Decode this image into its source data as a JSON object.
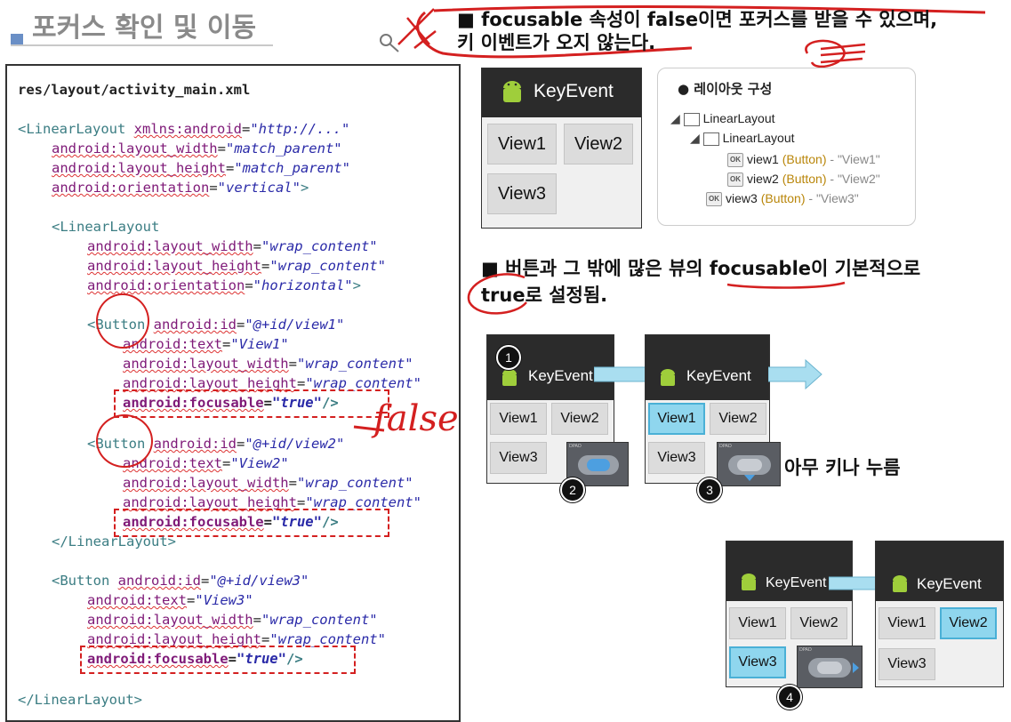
{
  "header": {
    "title": "포커스 확인 및 이동"
  },
  "code": {
    "file": "res/layout/activity_main.xml",
    "lines": {
      "l1_tag": "<LinearLayout",
      "l1_attr": "xmlns:android",
      "l1_val": "\"http://...\"",
      "l2_attr": "android:layout_width",
      "l2_val": "\"match_parent\"",
      "l3_attr": "android:layout_height",
      "l3_val": "\"match_parent\"",
      "l4_attr": "android:orientation",
      "l4_val": "\"vertical\"",
      "l4_end": ">",
      "l5_tag": "<LinearLayout",
      "l6_attr": "android:layout_width",
      "l6_val": "\"wrap_content\"",
      "l7_attr": "android:layout_height",
      "l7_val": "\"wrap_content\"",
      "l8_attr": "android:orientation",
      "l8_val": "\"horizontal\"",
      "l8_end": ">",
      "b1_tag": "<Button",
      "b1_attr": "android:id",
      "b1_val": "\"@+id/view1\"",
      "b1_text_attr": "android:text",
      "b1_text_val": "\"View1\"",
      "b1_w_attr": "android:layout_width",
      "b1_w_val": "\"wrap_content\"",
      "b1_h_attr": "android:layout_height",
      "b1_h_val": "\"wrap_content\"",
      "b1_f_attr": "android:focusable",
      "b1_f_val": "\"true\"",
      "b1_end": "/>",
      "b2_tag": "<Button",
      "b2_attr": "android:id",
      "b2_val": "\"@+id/view2\"",
      "b2_text_attr": "android:text",
      "b2_text_val": "\"View2\"",
      "b2_w_attr": "android:layout_width",
      "b2_w_val": "\"wrap_content\"",
      "b2_h_attr": "android:layout_height",
      "b2_h_val": "\"wrap_content\"",
      "b2_f_attr": "android:focusable",
      "b2_f_val": "\"true\"",
      "b2_end": "/>",
      "close_inner": "</LinearLayout>",
      "b3_tag": "<Button",
      "b3_attr": "android:id",
      "b3_val": "\"@+id/view3\"",
      "b3_text_attr": "android:text",
      "b3_text_val": "\"View3\"",
      "b3_w_attr": "android:layout_width",
      "b3_w_val": "\"wrap_content\"",
      "b3_h_attr": "android:layout_height",
      "b3_h_val": "\"wrap_content\"",
      "b3_f_attr": "android:focusable",
      "b3_f_val": "\"true\"",
      "b3_end": "/>",
      "close_outer": "</LinearLayout>"
    },
    "handwritten": "false"
  },
  "notes": {
    "note1_line1": "■ focusable 속성이 false이면 포커스를 받을 수 있으며,",
    "note1_line2": "키 이벤트가 오지 않는다.",
    "note2_line1": "■ 버튼과 그 밖에 많은 뷰의 focusable이 기본적으로",
    "note2_line2": "true로 설정됨.",
    "any_key": "아무 키나 누름"
  },
  "app": {
    "title": "KeyEvent",
    "view1": "View1",
    "view2": "View2",
    "view3": "View3"
  },
  "tree": {
    "heading": "● 레이아웃 구성",
    "root": "LinearLayout",
    "child": "LinearLayout",
    "item1_name": "view1",
    "item1_type": "(Button)",
    "item1_text": "- \"View1\"",
    "item2_name": "view2",
    "item2_type": "(Button)",
    "item2_text": "- \"View2\"",
    "item3_name": "view3",
    "item3_type": "(Button)",
    "item3_text": "- \"View3\"",
    "ok_label": "OK"
  },
  "steps": {
    "s1": "1",
    "s2": "2",
    "s3": "3",
    "s4": "4",
    "dpad_label": "DPAD"
  },
  "colors": {
    "focus_fill": "#8fd6ee",
    "annotation_red": "#d42020",
    "arrow_blue": "#9bd9ee"
  }
}
